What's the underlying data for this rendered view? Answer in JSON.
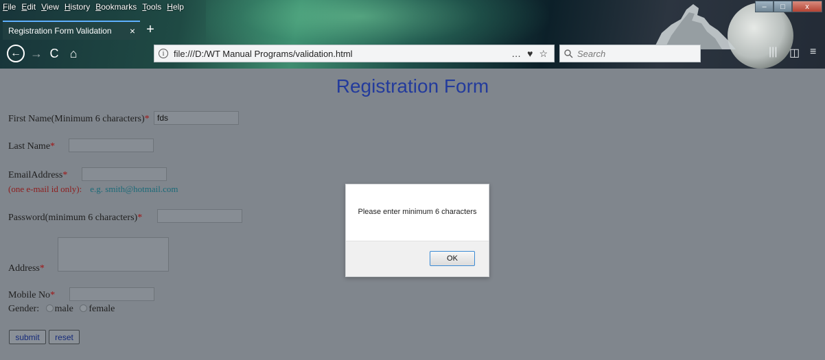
{
  "menubar": {
    "items": [
      "File",
      "Edit",
      "View",
      "History",
      "Bookmarks",
      "Tools",
      "Help"
    ]
  },
  "tab": {
    "title": "Registration Form Validation",
    "close_glyph": "×",
    "new_tab_glyph": "+"
  },
  "nav": {
    "back_glyph": "←",
    "forward_glyph": "→",
    "reload_glyph": "C",
    "home_glyph": "⌂"
  },
  "address_bar": {
    "url": "file:///D:/WT Manual Programs/validation.html",
    "info_glyph": "i"
  },
  "search_bar": {
    "placeholder": "Search"
  },
  "toolbar_icons": {
    "page_actions": "…",
    "pocket": "♥",
    "bookmark_star": "☆",
    "library": "|||",
    "sidebar": "◫",
    "menu": "≡"
  },
  "window_controls": {
    "minimize": "–",
    "maximize": "□",
    "close": "x"
  },
  "form": {
    "title": "Registration Form",
    "required_mark": "*",
    "first_name_label": "First Name(Minimum 6 characters)",
    "first_name_value": "fds",
    "last_name_label": "Last Name",
    "email_label": "EmailAddress",
    "email_note": "(one e-mail id only):",
    "email_example": "e.g. smith@hotmail.com",
    "password_label": "Password(minimum 6 characters)",
    "address_label": "Address",
    "mobile_label": "Mobile No",
    "gender_label": "Gender:",
    "gender_male": "male",
    "gender_female": "female",
    "submit_label": "submit",
    "reset_label": "reset"
  },
  "dialog": {
    "message": "Please enter minimum 6 characters",
    "ok_label": "OK"
  }
}
